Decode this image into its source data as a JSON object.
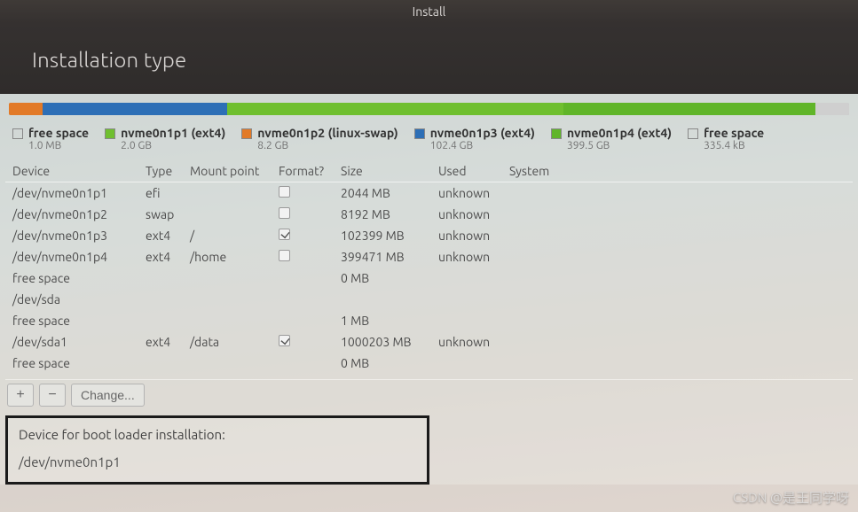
{
  "window": {
    "title": "Install"
  },
  "header": {
    "title": "Installation type"
  },
  "disk_bar": [
    {
      "color": "c-orange",
      "width": "4%"
    },
    {
      "color": "c-blue",
      "width": "22%"
    },
    {
      "color": "c-green",
      "width": "40%"
    },
    {
      "color": "c-green2",
      "width": "30%"
    },
    {
      "color": "c-grey",
      "width": "4%"
    }
  ],
  "legend": [
    {
      "swatch": "empty",
      "title": "free space",
      "sub": "1.0 MB"
    },
    {
      "swatch": "c-green",
      "title": "nvme0n1p1 (ext4)",
      "sub": "2.0 GB"
    },
    {
      "swatch": "c-orange",
      "title": "nvme0n1p2 (linux-swap)",
      "sub": "8.2 GB"
    },
    {
      "swatch": "c-blue",
      "title": "nvme0n1p3 (ext4)",
      "sub": "102.4 GB"
    },
    {
      "swatch": "c-green2",
      "title": "nvme0n1p4 (ext4)",
      "sub": "399.5 GB"
    },
    {
      "swatch": "empty",
      "title": "free space",
      "sub": "335.4 kB"
    }
  ],
  "columns": {
    "device": "Device",
    "type": "Type",
    "mount": "Mount point",
    "format": "Format?",
    "size": "Size",
    "used": "Used",
    "system": "System"
  },
  "rows": [
    {
      "device": "/dev/nvme0n1p1",
      "type": "efi",
      "mount": "",
      "format": false,
      "size": "2044 MB",
      "used": "unknown",
      "system": ""
    },
    {
      "device": "/dev/nvme0n1p2",
      "type": "swap",
      "mount": "",
      "format": false,
      "size": "8192 MB",
      "used": "unknown",
      "system": ""
    },
    {
      "device": "/dev/nvme0n1p3",
      "type": "ext4",
      "mount": "/",
      "format": true,
      "size": "102399 MB",
      "used": "unknown",
      "system": ""
    },
    {
      "device": "/dev/nvme0n1p4",
      "type": "ext4",
      "mount": "/home",
      "format": false,
      "size": "399471 MB",
      "used": "unknown",
      "system": ""
    },
    {
      "device": "free space",
      "type": "",
      "mount": "",
      "format": null,
      "size": "0 MB",
      "used": "",
      "system": ""
    },
    {
      "device": "/dev/sda",
      "type": "",
      "mount": "",
      "format": null,
      "size": "",
      "used": "",
      "system": ""
    },
    {
      "device": "free space",
      "type": "",
      "mount": "",
      "format": null,
      "size": "1 MB",
      "used": "",
      "system": ""
    },
    {
      "device": "/dev/sda1",
      "type": "ext4",
      "mount": "/data",
      "format": true,
      "size": "1000203 MB",
      "used": "unknown",
      "system": ""
    },
    {
      "device": "free space",
      "type": "",
      "mount": "",
      "format": null,
      "size": "0 MB",
      "used": "",
      "system": ""
    }
  ],
  "toolbar": {
    "add": "+",
    "remove": "−",
    "change": "Change..."
  },
  "bootloader": {
    "label": "Device for boot loader installation:",
    "value": "/dev/nvme0n1p1"
  },
  "watermark": "CSDN @是王同学呀"
}
